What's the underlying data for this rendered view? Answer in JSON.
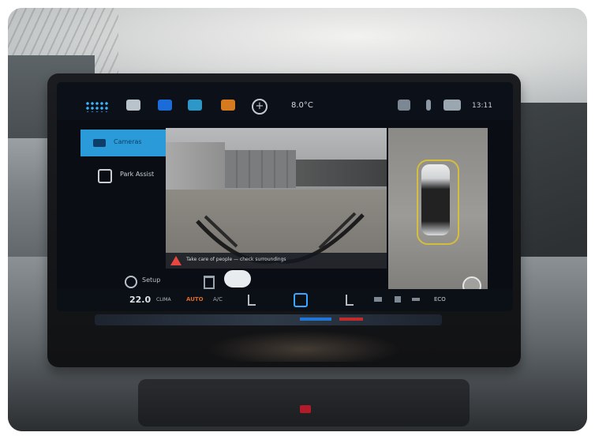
{
  "status_bar": {
    "temperature": "8.0°C",
    "clock": "13:11"
  },
  "menu": {
    "items": [
      {
        "label": "Cameras",
        "active": true
      },
      {
        "label": "Park Assist",
        "active": false
      }
    ],
    "setup_label": "Setup"
  },
  "camera": {
    "warning": "Take care of people — check surroundings"
  },
  "bottom_bar": {
    "temperature": "22.0",
    "climate_label": "CLIMA",
    "auto_label": "AUTO",
    "ac_label": "A/C",
    "eco_label": "ECO"
  },
  "colors": {
    "accent_blue": "#2a9bd8",
    "warning_red": "#e8463f",
    "auto_orange": "#d86a2a"
  }
}
